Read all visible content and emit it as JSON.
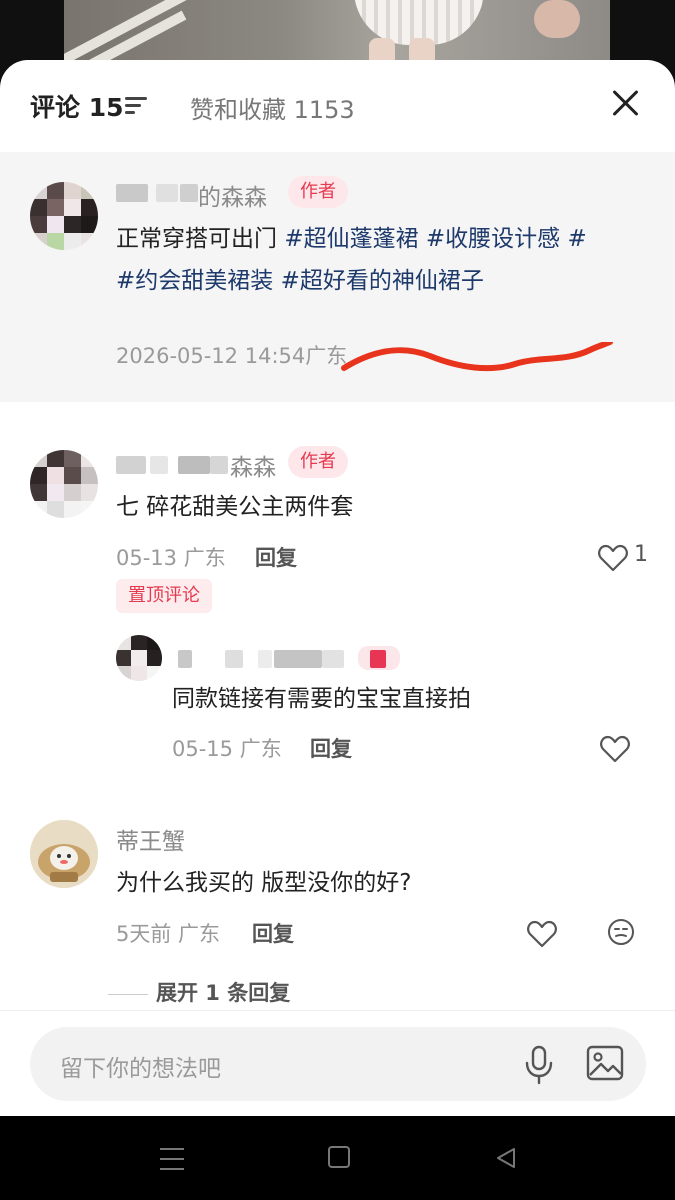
{
  "header": {
    "comments_tab": "评论 15",
    "likes_tab": "赞和收藏 1153"
  },
  "pinned_post": {
    "username_visible": "的森森",
    "author_badge": "作者",
    "text_plain": "正常穿搭可出门 ",
    "tags": [
      "#超仙蓬蓬裙",
      "#收腰设计感",
      "#约会甜美裙装",
      "#超好看的神仙裙子"
    ],
    "meta": "2026-05-12 14:54广东"
  },
  "comments": [
    {
      "username_visible": "森森",
      "author_badge": "作者",
      "text": "七 碎花甜美公主两件套",
      "date": "05-13 广东",
      "reply": "回复",
      "likes": "1",
      "pin_label": "置顶评论",
      "replies": [
        {
          "text": "同款链接有需要的宝宝直接拍",
          "date": "05-15 广东",
          "reply": "回复"
        }
      ]
    },
    {
      "username": "蒂王蟹",
      "text": "为什么我买的 版型没你的好?",
      "date": "5天前 广东",
      "reply": "回复",
      "expand": "展开 1 条回复"
    }
  ],
  "input": {
    "placeholder": "留下你的想法吧"
  },
  "colors": {
    "accent": "#e63a4f",
    "tag": "#1d3a6b",
    "scribble": "#e8341c"
  },
  "icons": [
    "sort-icon",
    "close-icon",
    "heart-icon",
    "emoji-icon",
    "mic-icon",
    "image-icon",
    "menu-icon",
    "home-icon",
    "back-icon"
  ]
}
